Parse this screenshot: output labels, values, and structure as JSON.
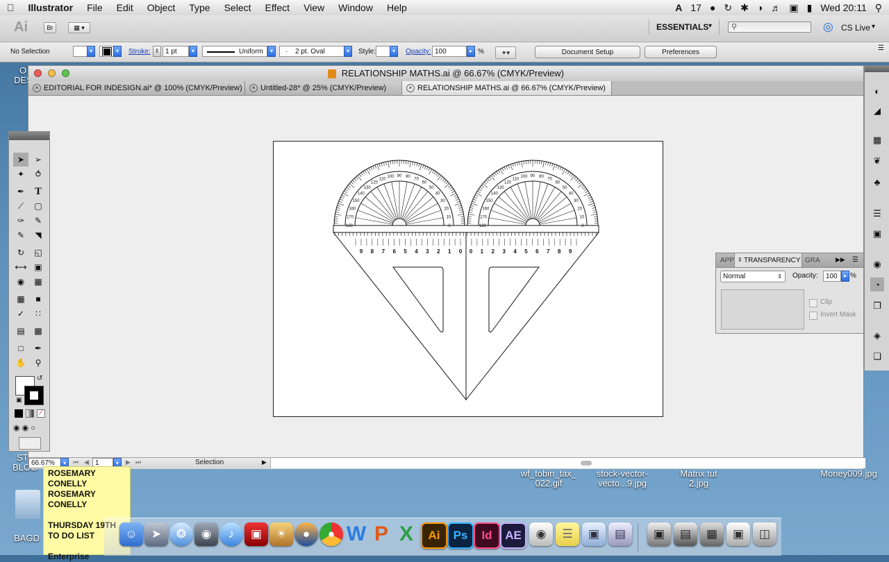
{
  "menubar": {
    "items": [
      "Illustrator",
      "File",
      "Edit",
      "Object",
      "Type",
      "Select",
      "Effect",
      "View",
      "Window",
      "Help"
    ],
    "status_number": "17",
    "clock": "Wed 20:11"
  },
  "appbar": {
    "ai_label": "Ai",
    "br_label": "Br",
    "workspace": "ESSENTIALS",
    "cs_live": "CS Live"
  },
  "controlbar": {
    "selection": "No Selection",
    "stroke_label": "Stroke:",
    "stroke_weight": "1 pt",
    "profile": "Uniform",
    "brush": "2 pt. Oval",
    "style_label": "Style:",
    "opacity_label": "Opacity:",
    "opacity_value": "100",
    "opacity_unit": "%",
    "document_setup": "Document Setup",
    "preferences": "Preferences"
  },
  "document": {
    "title": "RELATIONSHIP MATHS.ai @ 66.67% (CMYK/Preview)",
    "tabs": [
      {
        "label": "EDITORIAL FOR INDESIGN.ai* @ 100% (CMYK/Preview)"
      },
      {
        "label": "Untitled-28* @ 25% (CMYK/Preview)"
      },
      {
        "label": "RELATIONSHIP MATHS.ai @ 66.67% (CMYK/Preview)"
      }
    ],
    "zoom": "66.67%",
    "artboard_number": "1",
    "status_tool": "Selection"
  },
  "protractor_labels": [
    "0",
    "10",
    "20",
    "30",
    "40",
    "50",
    "60",
    "70",
    "80",
    "90",
    "100",
    "110",
    "120",
    "130",
    "140",
    "150",
    "160",
    "170",
    "180"
  ],
  "ruler_left": [
    "9",
    "8",
    "7",
    "6",
    "5",
    "4",
    "3",
    "2",
    "1",
    "0"
  ],
  "ruler_right": [
    "0",
    "1",
    "2",
    "3",
    "4",
    "5",
    "6",
    "7",
    "8",
    "9"
  ],
  "transparency_panel": {
    "tab_appearance": "APPI",
    "tab_transparency": "TRANSPARENCY",
    "tab_gradient": "GRA",
    "blend_mode": "Normal",
    "opacity_label": "Opacity:",
    "opacity_value": "100",
    "opacity_unit": "%",
    "clip_label": "Clip",
    "invert_mask_label": "Invert Mask"
  },
  "desktop": {
    "files": [
      {
        "name": "wf_tobin_tax_\n022.gif"
      },
      {
        "name": "stock-vector-\nvecto...9.jpg"
      },
      {
        "name": "Matrix tut\n2.jpg"
      },
      {
        "name": "Money009.jpg"
      }
    ],
    "left_labels": [
      "O",
      "DES",
      "ST",
      "BLOG",
      "BAGD",
      "TH"
    ],
    "sticky_lines": [
      "ROSEMARY",
      "CONELLY",
      "ROSEMARY",
      "CONELLY",
      "",
      "THURSDAY 19TH",
      "TO DO LIST",
      "",
      "Enterprise"
    ]
  },
  "dock": {
    "apps": [
      {
        "label": "Ai",
        "color": "#3a2400",
        "fg": "#ff9a00"
      },
      {
        "label": "Ps",
        "color": "#0b2340",
        "fg": "#37b3ff"
      },
      {
        "label": "Id",
        "color": "#3d0a1f",
        "fg": "#ff4f8a"
      },
      {
        "label": "AE",
        "color": "#1d1b3d",
        "fg": "#c7b6ff"
      }
    ]
  },
  "colors": {
    "accent": "#2a6de0",
    "link": "#1a3ebd",
    "sticky": "#fffaa3"
  }
}
